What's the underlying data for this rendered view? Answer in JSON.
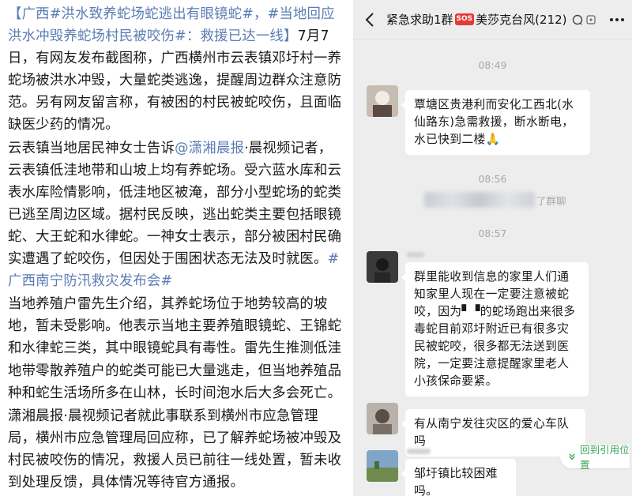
{
  "article": {
    "p1_tag1": "【广西#洪水致养蛇场蛇逃出有眼镜蛇#，#当地回应洪水冲毁养蛇场村民被咬伤#：救援已达一线】",
    "p1_text": "7月7日，有网友发布截图称，广西横州市云表镇邓圩村一养蛇场被洪水冲毁，大量蛇类逃逸，提醒周边群众注意防范。另有网友留言称，有被困的村民被蛇咬伤，且面临缺医少药的情况。",
    "p2_a": "云表镇当地居民神女士告诉",
    "p2_mention": "@潇湘晨报",
    "p2_b": "·晨视频记者，云表镇低洼地带和山坡上均有养蛇场。受六蓝水库和云表水库险情影响，低洼地区被淹，部分小型蛇场的蛇类已逃至周边区域。据村民反映，逃出蛇类主要包括眼镜蛇、大王蛇和水律蛇。一神女士表示，部分被困村民确实遭遇了蛇咬伤，但因处于围困状态无法及时就医。",
    "p2_tag": "#广西南宁防汛救灾发布会#",
    "p3": "当地养殖户雷先生介绍，其养蛇场位于地势较高的坡地，暂未受影响。他表示当地主要养殖眼镜蛇、王锦蛇和水律蛇三类，其中眼镜蛇具有毒性。雷先生推测低洼地带零散养殖户的蛇类可能已大量逃走，但当地养殖品种和蛇生活场所多在山林，长时间泡水后大多会死亡。",
    "p4": "潇湘晨报·晨视频记者就此事联系到横州市应急管理局，横州市应急管理局回应称，已了解养蛇场被冲毁及村民被咬伤的情况，救援人员已前往一线处置，暂未收到处理反馈，具体情况等待官方通报。"
  },
  "chat": {
    "title_prefix": "紧急求助1群",
    "sos_label": "SOS",
    "title_suffix": "美莎克台风(212)",
    "times": [
      "08:49",
      "08:56",
      "08:57"
    ],
    "system_text": "了群聊",
    "messages": [
      "覃塘区贵港利而安化工西北(水仙路东)急需救援，断水断电，水已快到二楼🙏",
      "群里能收到信息的家里人们通知家里人现在一定要注意被蛇咬，因为▘▝的蛇场跑出来很多毒蛇目前邓圩附近已有很多灾民被蛇咬，很多都无法送到医院，一定要注意提醒家里老人小孩保命要紧。",
      "有从南宁发往灾区的爱心车队吗",
      "邹圩镇比较困难吗。"
    ],
    "jump_label": "回到引用位置"
  },
  "colors": {
    "link": "#5b7cb5",
    "accent_green": "#3aa35a",
    "sos_red": "#e53935",
    "chat_bg": "#ededed"
  }
}
